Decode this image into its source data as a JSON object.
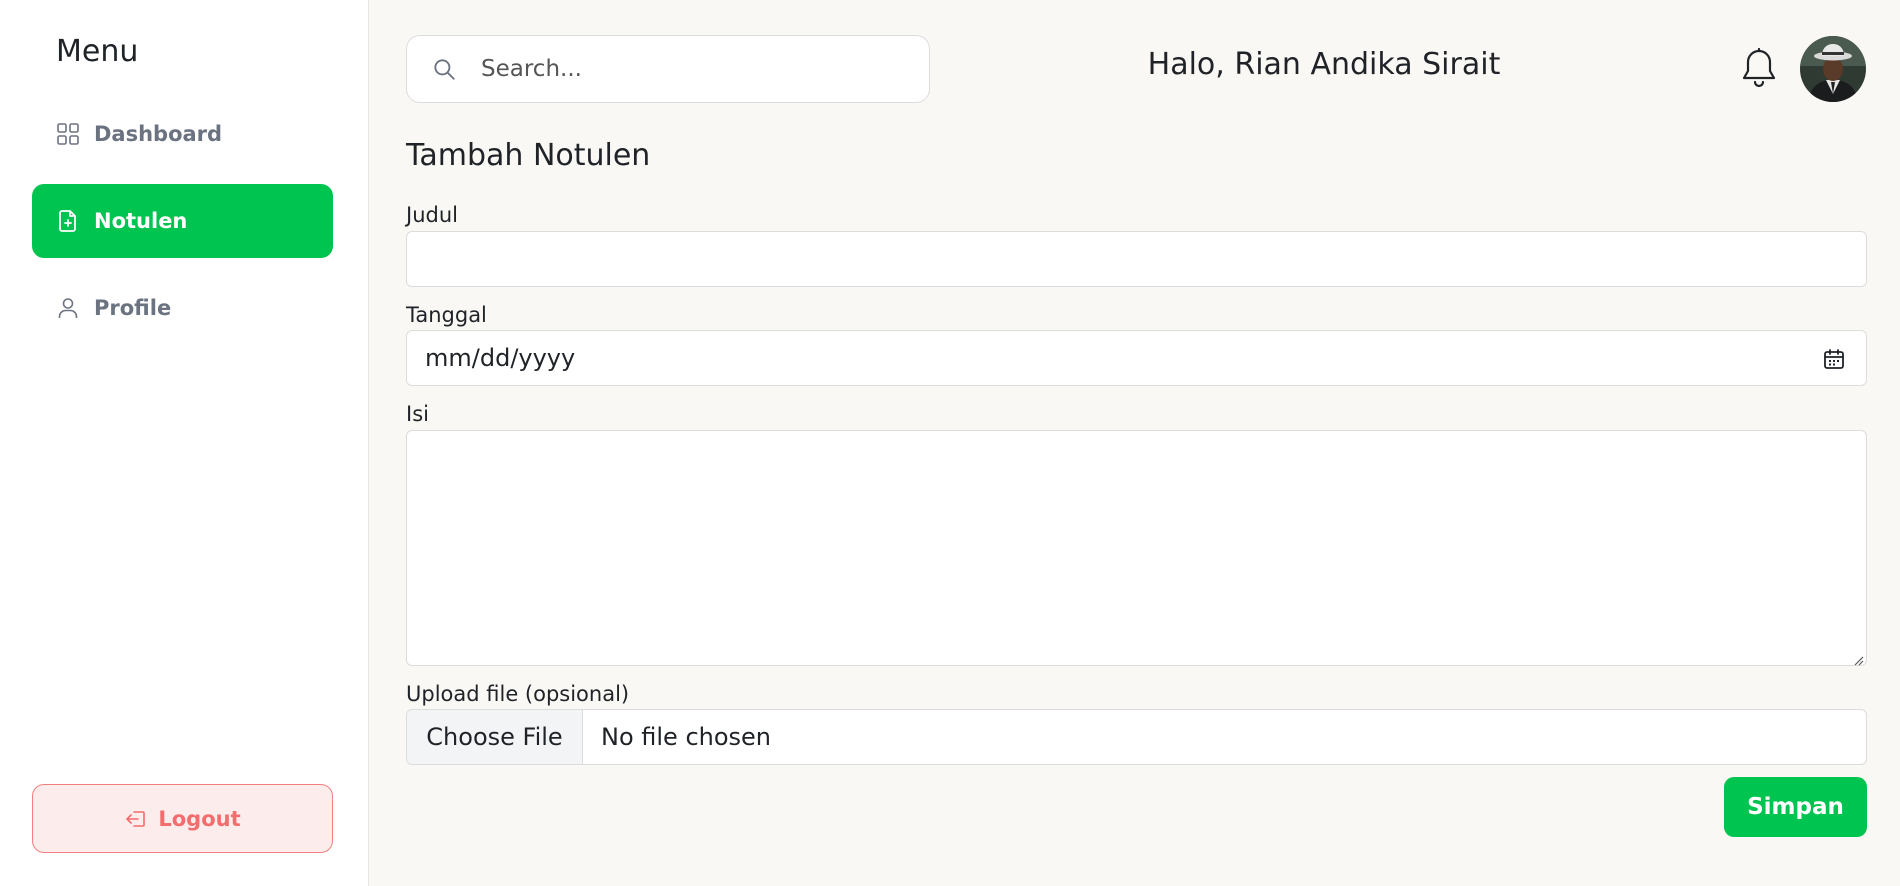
{
  "sidebar": {
    "title": "Menu",
    "items": [
      {
        "label": "Dashboard",
        "icon": "grid-icon",
        "active": false
      },
      {
        "label": "Notulen",
        "icon": "file-plus-icon",
        "active": true
      },
      {
        "label": "Profile",
        "icon": "user-icon",
        "active": false
      }
    ],
    "logout_label": "Logout"
  },
  "header": {
    "search_placeholder": "Search...",
    "greeting": "Halo, Rian Andika Sirait"
  },
  "form": {
    "title": "Tambah Notulen",
    "judul_label": "Judul",
    "judul_value": "",
    "tanggal_label": "Tanggal",
    "tanggal_placeholder": "mm/dd/yyyy",
    "isi_label": "Isi",
    "isi_value": "",
    "upload_label": "Upload file (opsional)",
    "choose_file_label": "Choose File",
    "no_file_text": "No file chosen",
    "save_label": "Simpan"
  },
  "colors": {
    "accent": "#00c450",
    "logout_text": "#f26d6d",
    "logout_bg": "#fdecec",
    "page_bg": "#faf8f4"
  }
}
